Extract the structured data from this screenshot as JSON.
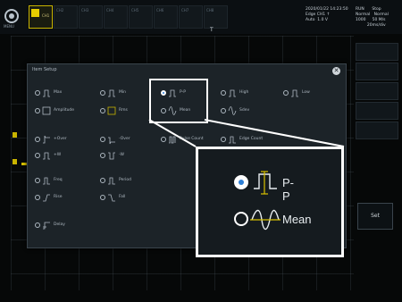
{
  "topbar": {
    "menu_label": "MENU",
    "channels": [
      "CH1",
      "CH2",
      "CH3",
      "CH4",
      "CH5",
      "CH6",
      "CH7",
      "CH8"
    ],
    "status_lines": "2020/01/22 14:23:50\nEdge CH1 ↑\nAuto  1.0 V",
    "acq_lines": "RUN      Stop\nNormal   Normal\n1000     50 M/s\n         20ms/div",
    "trigger_marker": "T"
  },
  "dialog": {
    "title": "Item Setup",
    "close_glyph": "✕",
    "options": [
      {
        "label": "Max",
        "selected": false
      },
      {
        "label": "Min",
        "selected": false
      },
      {
        "label": "P-P",
        "selected": true
      },
      {
        "label": "High",
        "selected": false
      },
      {
        "label": "Low",
        "selected": false
      },
      {
        "label": "Amplitude",
        "selected": false
      },
      {
        "label": "Rms",
        "selected": false
      },
      {
        "label": "Mean",
        "selected": false
      },
      {
        "label": "Sdev",
        "selected": false
      },
      {
        "label": "+Over",
        "selected": false
      },
      {
        "label": "-Over",
        "selected": false
      },
      {
        "label": "Pulse Count",
        "selected": false
      },
      {
        "label": "Edge Count",
        "selected": false
      },
      {
        "label": "+W",
        "selected": false
      },
      {
        "label": "-W",
        "selected": false
      },
      {
        "label": "Freq",
        "selected": false
      },
      {
        "label": "Period",
        "selected": false
      },
      {
        "label": "Rise",
        "selected": false
      },
      {
        "label": "Fall",
        "selected": false
      },
      {
        "label": "Delay",
        "selected": false
      }
    ]
  },
  "zoom": {
    "option_pp": "P-P",
    "option_mean": "Mean"
  },
  "side": {
    "set_label": "Set"
  },
  "colors": {
    "accent": "#2d7fd6",
    "trace": "#d8c000",
    "highlight": "#ffffff"
  }
}
